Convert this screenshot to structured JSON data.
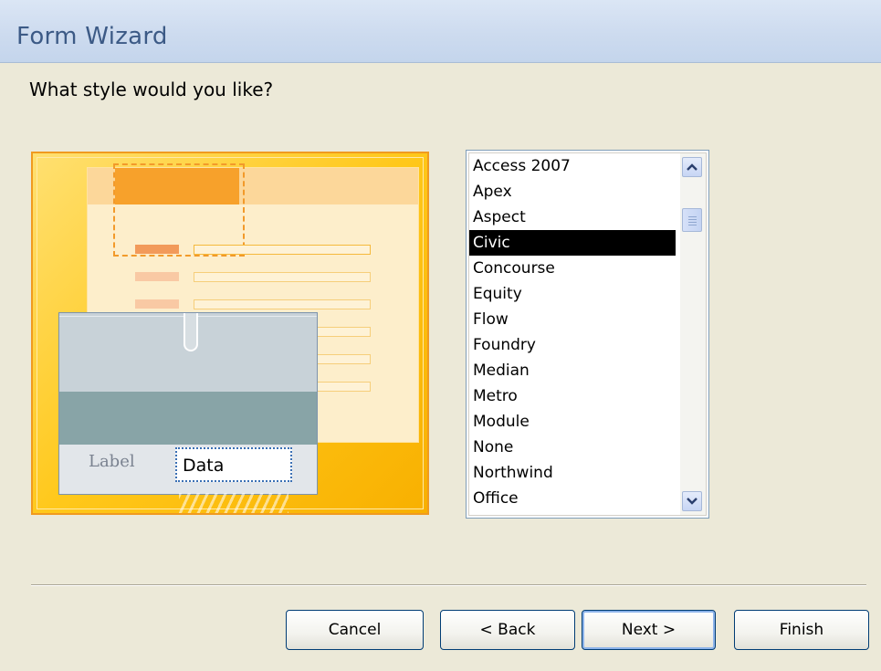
{
  "window": {
    "title": "Form Wizard"
  },
  "question": "What style would you like?",
  "preview": {
    "label_text": "Label",
    "data_text": "Data"
  },
  "styles": {
    "selected": "Civic",
    "items": [
      {
        "label": "Access 2007"
      },
      {
        "label": "Apex"
      },
      {
        "label": "Aspect"
      },
      {
        "label": "Civic"
      },
      {
        "label": "Concourse"
      },
      {
        "label": "Equity"
      },
      {
        "label": "Flow"
      },
      {
        "label": "Foundry"
      },
      {
        "label": "Median"
      },
      {
        "label": "Metro"
      },
      {
        "label": "Module"
      },
      {
        "label": "None"
      },
      {
        "label": "Northwind"
      },
      {
        "label": "Office"
      }
    ]
  },
  "buttons": {
    "cancel": "Cancel",
    "back": "< Back",
    "next": "Next >",
    "finish": "Finish"
  },
  "colors": {
    "title_text": "#3c5a86",
    "selection_bg": "#000000",
    "preview_accent": "#f7a12b"
  },
  "icons": {
    "scroll_up": "chevron-up-icon",
    "scroll_down": "chevron-down-icon"
  }
}
